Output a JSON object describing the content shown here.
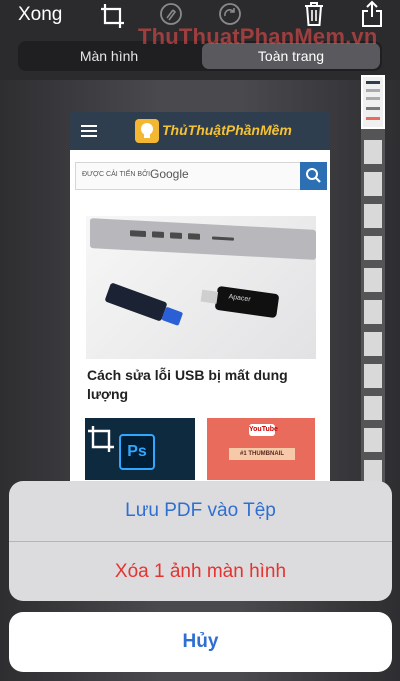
{
  "toolbar": {
    "done_label": "Xong",
    "icons": [
      "crop-icon",
      "markup-pen-icon",
      "redo-icon",
      "trash-icon",
      "share-icon"
    ]
  },
  "segmented": {
    "screen_label": "Màn hình",
    "full_page_label": "Toàn trang",
    "selected": "full_page"
  },
  "watermark": {
    "text": "ThuThuatPhanMem.vn"
  },
  "preview": {
    "logo_text": "ThủThuậtPhầnMềm",
    "search": {
      "hint": "ĐƯỢC CẢI TIẾN BỞI",
      "brand": "Google"
    },
    "article_title": "Cách sửa lỗi USB bị mất dung lượng",
    "usb_label": "Apacer",
    "thumb_ps": "Ps",
    "thumb_yt_logo": "YouTube",
    "thumb_yt_label": "#1 THUMBNAIL"
  },
  "action_sheet": {
    "save_pdf_label": "Lưu PDF vào Tệp",
    "delete_label": "Xóa 1 ảnh màn hình",
    "cancel_label": "Hủy"
  },
  "colors": {
    "accent": "#2e6fd1",
    "destructive": "#e3342f",
    "sheet_bg": "#dcdcdf"
  }
}
